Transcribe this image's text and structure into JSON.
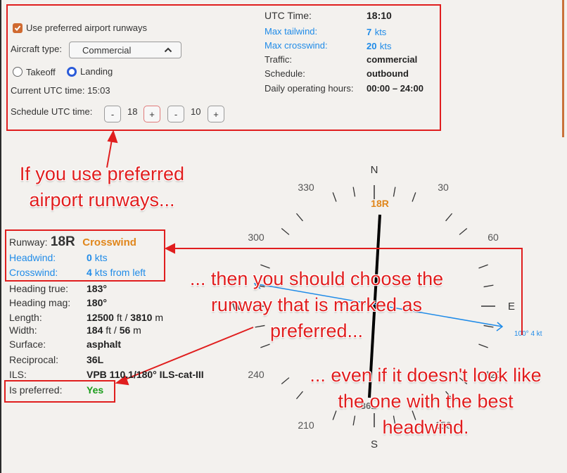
{
  "controls": {
    "use_preferred_label": "Use preferred airport runways",
    "aircraft_type_label": "Aircraft type:",
    "aircraft_type_value": "Commercial",
    "takeoff_label": "Takeoff",
    "landing_label": "Landing",
    "selected_mode": "Landing",
    "current_utc": "Current UTC time:  15:03",
    "schedule_label": "Schedule UTC time:",
    "minus": "-",
    "plus": "+",
    "sched_hour": "18",
    "sched_min": "10"
  },
  "info": {
    "utc_label": "UTC Time:",
    "utc_value": "18:10",
    "tail_label": "Max tailwind:",
    "tail_value": "7",
    "tail_unit": "kts",
    "cross_label": "Max crosswind:",
    "cross_value": "20",
    "cross_unit": "kts",
    "traffic_label": "Traffic:",
    "traffic_value": "commercial",
    "schedule_label": "Schedule:",
    "schedule_value": "outbound",
    "hours_label": "Daily operating hours:",
    "hours_value": "00:00 – 24:00"
  },
  "runway": {
    "label": "Runway:",
    "name": "18R",
    "status": "Crosswind",
    "headwind_label": "Headwind:",
    "headwind_value": "0",
    "headwind_unit": "kts",
    "crosswind_label": "Crosswind:",
    "crosswind_value": "4",
    "crosswind_suffix": "kts from left",
    "heading_true_label": "Heading true:",
    "heading_true": "183°",
    "heading_mag_label": "Heading mag:",
    "heading_mag": "180°",
    "length_label": "Length:",
    "length_ft": "12500",
    "length_ft_unit": "ft /",
    "length_m": "3810",
    "length_m_unit": "m",
    "width_label": "Width:",
    "width_ft": "184",
    "width_ft_unit": "ft /",
    "width_m": "56",
    "width_m_unit": "m",
    "surface_label": "Surface:",
    "surface": "asphalt",
    "reciprocal_label": "Reciprocal:",
    "reciprocal": "36L",
    "ils_label": "ILS:",
    "ils": "VPB 110.1/180° ILS-cat-III",
    "preferred_label": "Is preferred:",
    "preferred": "Yes"
  },
  "compass": {
    "north": "N",
    "south": "S",
    "east": "E",
    "west": "W",
    "labels": [
      "330",
      "30",
      "300",
      "60",
      "240",
      "120",
      "210",
      "150"
    ],
    "runway_top": "18R",
    "runway_bottom": "36L",
    "wind_label": "100° 4 kt"
  },
  "annotations": {
    "a1_l1": "If you use preferred",
    "a1_l2": "airport runways...",
    "a2_l1": "... then you should choose the",
    "a2_l2": "runway that is marked as",
    "a2_l3": "preferred...",
    "a3_l1": "... even if it doesn't look like",
    "a3_l2": "the one with the best",
    "a3_l3": "headwind."
  },
  "colors": {
    "accent": "#e01e1e",
    "link": "#1f8be8",
    "orange": "#e0861b",
    "green": "#1a9c1a"
  }
}
